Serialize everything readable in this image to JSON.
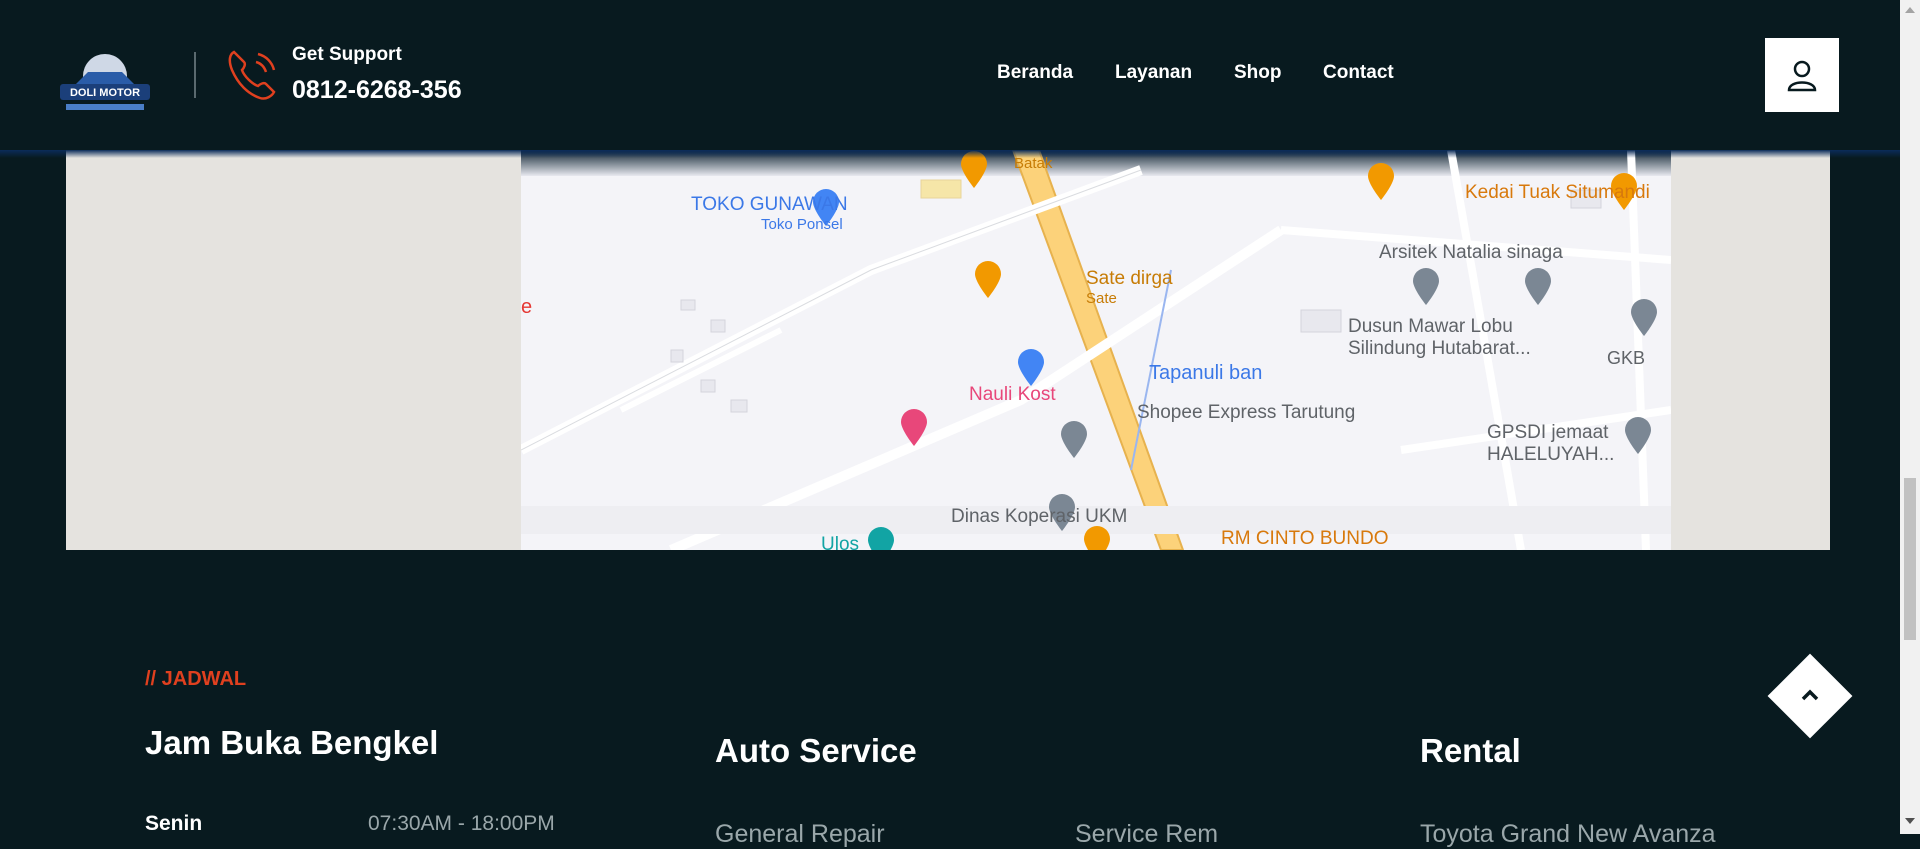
{
  "header": {
    "support_label": "Get Support",
    "support_phone": "0812-6268-356",
    "logo_text": "DOLI MOTOR",
    "nav": [
      {
        "label": "Beranda"
      },
      {
        "label": "Layanan"
      },
      {
        "label": "Shop"
      },
      {
        "label": "Contact"
      }
    ]
  },
  "map": {
    "labels": [
      {
        "text": "Batak"
      },
      {
        "text": "TOKO GUNAWAN"
      },
      {
        "text": "Toko Ponsel"
      },
      {
        "text": "Sate dirga"
      },
      {
        "text": "Sate"
      },
      {
        "text": "Kedai Tuak Situmandi"
      },
      {
        "text": "Arsitek Natalia sinaga"
      },
      {
        "text": "Dusun Mawar Lobu"
      },
      {
        "text": "Silindung Hutabarat..."
      },
      {
        "text": "GKB"
      },
      {
        "text": "Tapanuli ban"
      },
      {
        "text": "Nauli Kost"
      },
      {
        "text": "Shopee Express Tarutung"
      },
      {
        "text": "GPSDI jemaat"
      },
      {
        "text": "HALELUYAH..."
      },
      {
        "text": "Dinas Koperasi UKM"
      },
      {
        "text": "RM CINTO BUNDO"
      },
      {
        "text": "Ulos"
      },
      {
        "text": "e"
      }
    ]
  },
  "footer": {
    "subtitle": "// JADWAL",
    "hours_title": "Jam Buka Bengkel",
    "day": "Senin",
    "hours": "07:30AM - 18:00PM",
    "auto_title": "Auto Service",
    "rental_title": "Rental",
    "links": [
      "General Repair",
      "Service Rem",
      "Toyota Grand New Avanza"
    ]
  },
  "colors": {
    "background": "#081a1f",
    "accent": "#e0401f",
    "muted": "#9aa7aa"
  },
  "icons": [
    "phone-icon",
    "user-icon",
    "chevron-up-icon"
  ]
}
